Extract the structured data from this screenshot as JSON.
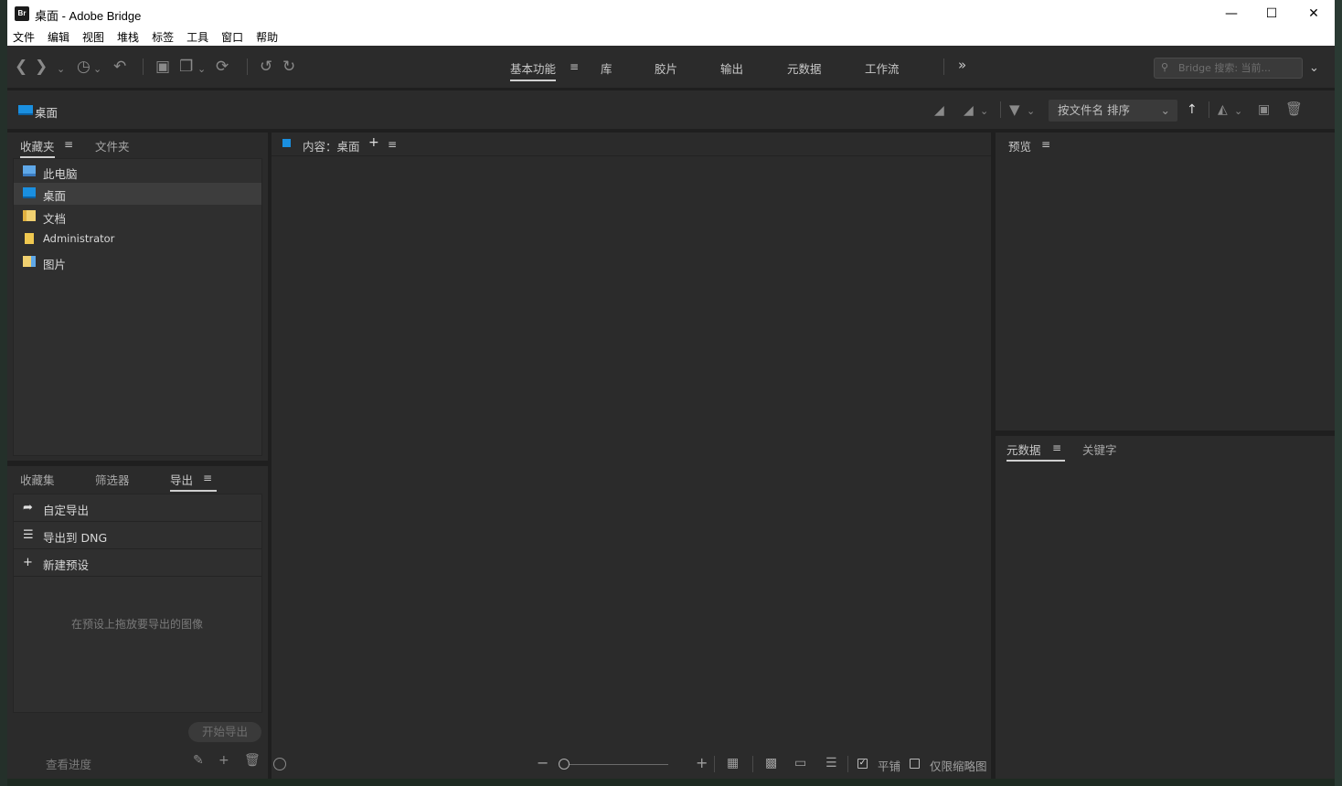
{
  "window": {
    "title": "桌面 - Adobe Bridge",
    "logo": "Br"
  },
  "menubar": [
    "文件",
    "编辑",
    "视图",
    "堆栈",
    "标签",
    "工具",
    "窗口",
    "帮助"
  ],
  "workspaces": {
    "tabs": [
      "基本功能",
      "库",
      "胶片",
      "输出",
      "元数据",
      "工作流"
    ],
    "active": "基本功能",
    "more": "»"
  },
  "search": {
    "placeholder": "Bridge 搜索: 当前..."
  },
  "path": {
    "current": "桌面"
  },
  "sort": {
    "label": "按文件名 排序"
  },
  "left_top_panel": {
    "tabs": [
      "收藏夹",
      "文件夹"
    ],
    "active": "收藏夹",
    "items": [
      {
        "label": "此电脑",
        "icon": "computer-icon"
      },
      {
        "label": "桌面",
        "icon": "desktop-icon",
        "selected": true
      },
      {
        "label": "文档",
        "icon": "documents-icon"
      },
      {
        "label": "Administrator",
        "icon": "user-folder-icon"
      },
      {
        "label": "图片",
        "icon": "pictures-icon"
      }
    ]
  },
  "left_bottom_panel": {
    "tabs": [
      "收藏集",
      "筛选器",
      "导出"
    ],
    "active": "导出",
    "items": [
      {
        "label": "自定导出",
        "icon": "export-icon"
      },
      {
        "label": "导出到 DNG",
        "icon": "list-icon"
      },
      {
        "label": "新建预设",
        "icon": "plus-icon"
      }
    ],
    "hint": "在预设上拖放要导出的图像",
    "start_button": "开始导出",
    "progress_link": "查看进度"
  },
  "content_panel": {
    "title": "内容：桌面",
    "add": "+",
    "bottom": {
      "tile_label": "平铺",
      "thumbs_only_label": "仅限缩略图",
      "tile_checked": true,
      "thumbs_only_checked": false
    }
  },
  "preview_panel": {
    "title": "预览"
  },
  "metadata_panel": {
    "tabs": [
      "元数据",
      "关键字"
    ],
    "active": "元数据"
  },
  "colors": {
    "background": "#1f1f1f",
    "panel": "#2b2b2b",
    "accent": "#1a8fe0"
  }
}
